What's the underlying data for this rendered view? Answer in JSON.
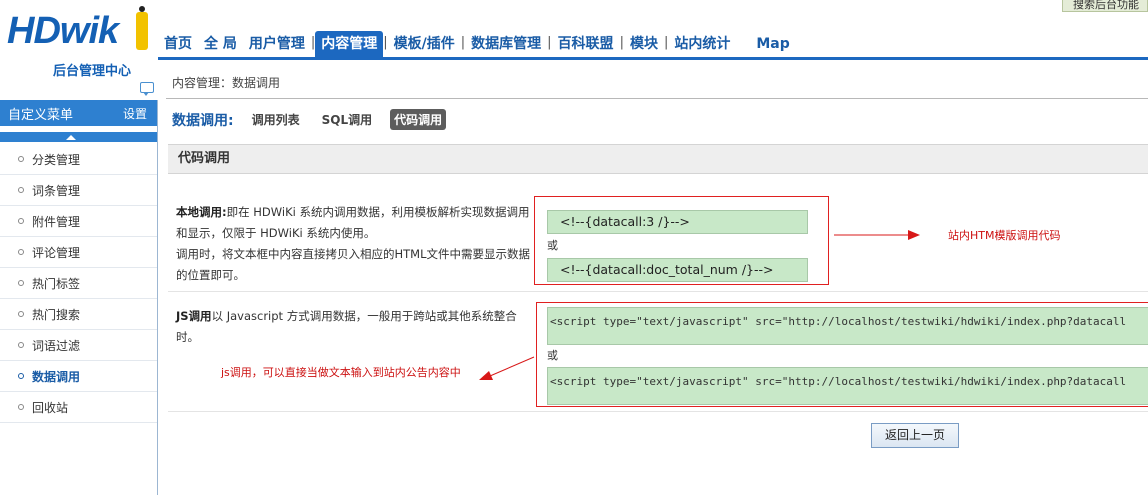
{
  "search_tab": {
    "label": "搜索后台功能"
  },
  "logo": {
    "text": "HDwik",
    "subtitle": "后台管理中心"
  },
  "topnav": [
    {
      "label": "首页"
    },
    {
      "label": "全 局"
    },
    {
      "label": "用户管理"
    },
    {
      "label": "内容管理"
    },
    {
      "label": "模板/插件"
    },
    {
      "label": "数据库管理"
    },
    {
      "label": "百科联盟"
    },
    {
      "label": "模块"
    },
    {
      "label": "站内统计"
    },
    {
      "label": "Map"
    }
  ],
  "sidebar": {
    "title": "自定义菜单",
    "settings_label": "设置",
    "items": [
      {
        "label": "分类管理"
      },
      {
        "label": "词条管理"
      },
      {
        "label": "附件管理"
      },
      {
        "label": "评论管理"
      },
      {
        "label": "热门标签"
      },
      {
        "label": "热门搜索"
      },
      {
        "label": "词语过滤"
      },
      {
        "label": "数据调用"
      },
      {
        "label": "回收站"
      }
    ]
  },
  "main": {
    "breadcrumb": "内容管理：数据调用",
    "subnav": {
      "title": "数据调用:",
      "links": [
        {
          "label": "调用列表"
        },
        {
          "label": "SQL调用"
        },
        {
          "label": "代码调用"
        }
      ]
    },
    "panel_title": "代码调用",
    "local": {
      "label": "本地调用:",
      "line1": "即在 HDWiKi 系统内调用数据，利用模板解析实现数据调用和显示，仅限于 HDWiKi 系统内使用。",
      "line2": "调用时，将文本框中内容直接拷贝入相应的HTML文件中需要显示数据的位置即可。",
      "code1": "<!--{datacall:3 /}-->",
      "or": "或",
      "code2": "<!--{datacall:doc_total_num /}-->"
    },
    "js": {
      "label": "JS调用",
      "text": "以 Javascript 方式调用数据，一般用于跨站或其他系统整合时。",
      "code1": "<script type=\"text/javascript\" src=\"http://localhost/testwiki/hdwiki/index.php?datacall",
      "or": "或",
      "code2": "<script type=\"text/javascript\" src=\"http://localhost/testwiki/hdwiki/index.php?datacall"
    },
    "annotation_local": "站内HTM模版调用代码",
    "annotation_js": "js调用，可以直接当做文本输入到站内公告内容中",
    "back_label": "返回上一页"
  }
}
